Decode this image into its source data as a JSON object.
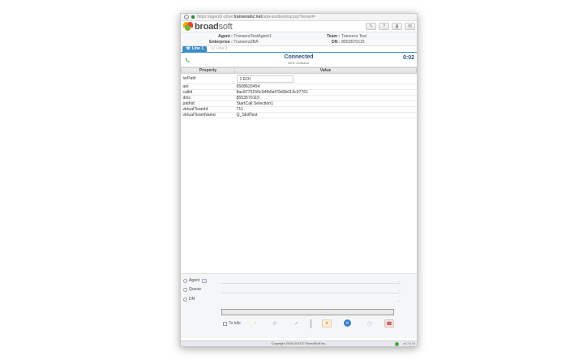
{
  "browser": {
    "url_prefix": "https://agent2-sbxe.",
    "url_domain": "transerainc.net",
    "url_suffix": "/ada-ws/desktop.jsp?tenant="
  },
  "header": {
    "brand_bold": "broad",
    "brand_rest": "soft",
    "icons": [
      "pin-icon",
      "help-icon",
      "chart-icon",
      "mail-icon"
    ]
  },
  "agent_info": {
    "agent_label": "Agent :",
    "agent_value": "TranseraTestAgent1",
    "enterprise_label": "Enterprise :",
    "enterprise_value": "Transera3BA",
    "team_label": "Team :",
    "team_value": "Transera Test",
    "dn_label": "DN :",
    "dn_value": "8553570115"
  },
  "tabs": [
    {
      "label": "Line 1",
      "active": true
    },
    {
      "label": "Line 2",
      "active": false
    }
  ],
  "call": {
    "status": "Connected",
    "substatus": "Next: Available",
    "timer": "0:02"
  },
  "properties": {
    "headers": [
      "Property",
      "Value"
    ],
    "rows": [
      {
        "property": "ivrPath",
        "value": "1 EOI"
      },
      {
        "property": "ani",
        "value": "6508620454"
      },
      {
        "property": "callid",
        "value": "8ac8775150c94fb5af79d3b013c97761"
      },
      {
        "property": "dnis",
        "value": "8553570115"
      },
      {
        "property": "pathid",
        "value": "StartCall Selection1"
      },
      {
        "property": "virtualTeamId",
        "value": "711"
      },
      {
        "property": "virtualTeamName",
        "value": "Q_SkillTest"
      }
    ]
  },
  "transfer": {
    "agent_label": "Agent",
    "queue_label": "Queue",
    "dn_label": "DN",
    "dn_value": ""
  },
  "controls": {
    "to_idle_label": "To Idle"
  },
  "colors": {
    "accent": "#3b8dc8",
    "status": "#2c4f8c",
    "ivr": "#7b3c9b"
  },
  "footer": {
    "copyright": "Copyright 2009-2016 © BroadSoft Inc.",
    "version": "v4.7.0.14"
  }
}
